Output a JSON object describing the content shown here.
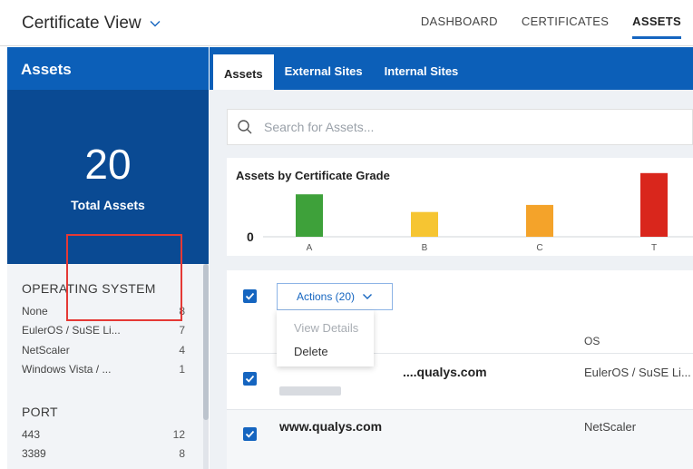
{
  "header": {
    "app_title": "Certificate View",
    "nav": [
      "DASHBOARD",
      "CERTIFICATES",
      "ASSETS"
    ],
    "active_nav": "ASSETS"
  },
  "sidebar": {
    "title": "Assets",
    "total_value": "20",
    "total_label": "Total Assets",
    "operating_system": {
      "title": "OPERATING SYSTEM",
      "items": [
        {
          "label": "None",
          "count": "8"
        },
        {
          "label": "EulerOS / SuSE Li...",
          "count": "7"
        },
        {
          "label": "NetScaler",
          "count": "4"
        },
        {
          "label": "Windows Vista / ...",
          "count": "1"
        }
      ]
    },
    "port": {
      "title": "PORT",
      "items": [
        {
          "label": "443",
          "count": "12"
        },
        {
          "label": "3389",
          "count": "8"
        }
      ]
    }
  },
  "tabs": [
    "Assets",
    "External Sites",
    "Internal Sites"
  ],
  "search": {
    "placeholder": "Search for Assets..."
  },
  "chart_data": {
    "type": "bar",
    "title": "Assets by Certificate Grade",
    "categories": [
      "A",
      "B",
      "C",
      "T"
    ],
    "values": [
      6,
      3.5,
      4.5,
      9
    ],
    "colors": [
      "#3ea13a",
      "#f6c532",
      "#f4a32a",
      "#d9261c"
    ],
    "y_tick_label": "0",
    "ylim": [
      0,
      10
    ],
    "grid": false,
    "legend": "none"
  },
  "table": {
    "actions_label": "Actions (20)",
    "menu": {
      "view_details": "View Details",
      "delete": "Delete"
    },
    "os_header": "OS",
    "rows": [
      {
        "name": "....qualys.com",
        "os": "EulerOS / SuSE Li..."
      },
      {
        "name": "www.qualys.com",
        "os": "NetScaler"
      }
    ]
  }
}
